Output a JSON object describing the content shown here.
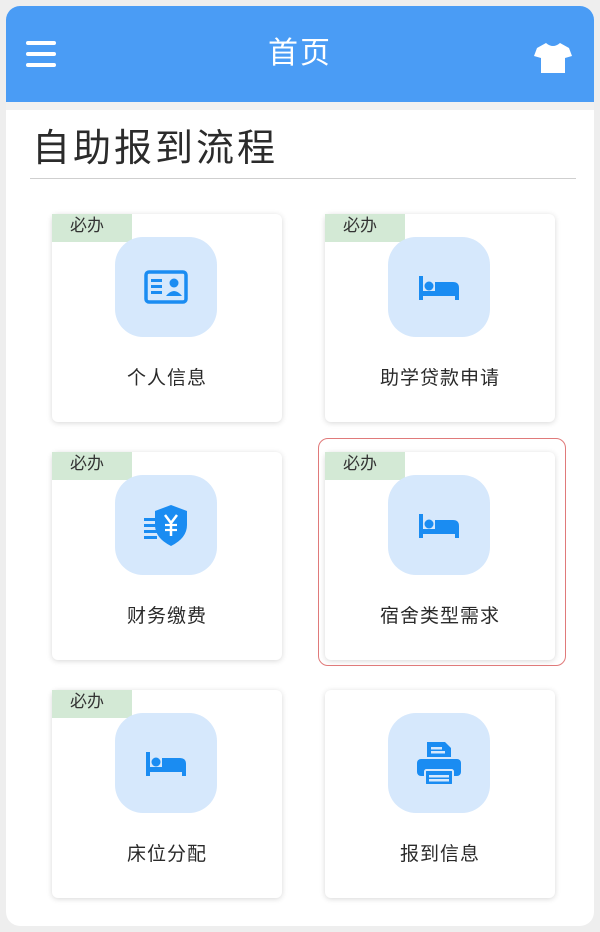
{
  "header": {
    "title": "首页",
    "menu_icon": "menu-icon",
    "right_icon": "shirt-icon"
  },
  "page": {
    "title": "自助报到流程"
  },
  "cards": [
    {
      "label": "个人信息",
      "badge": "必办",
      "icon": "id-card-icon"
    },
    {
      "label": "助学贷款申请",
      "badge": "必办",
      "icon": "bed-icon"
    },
    {
      "label": "财务缴费",
      "badge": "必办",
      "icon": "yuan-shield-icon"
    },
    {
      "label": "宿舍类型需求",
      "badge": "必办",
      "icon": "bed-icon",
      "selected": true
    },
    {
      "label": "床位分配",
      "badge": "必办",
      "icon": "bed-icon"
    },
    {
      "label": "报到信息",
      "badge": "",
      "icon": "printer-icon"
    }
  ],
  "colors": {
    "header_bg": "#4a9cf5",
    "icon_blue": "#1a8cf2",
    "icon_tile_bg": "#d6e8fc",
    "badge_bg": "#d3e9d5",
    "highlight_border": "#e07a7a"
  }
}
